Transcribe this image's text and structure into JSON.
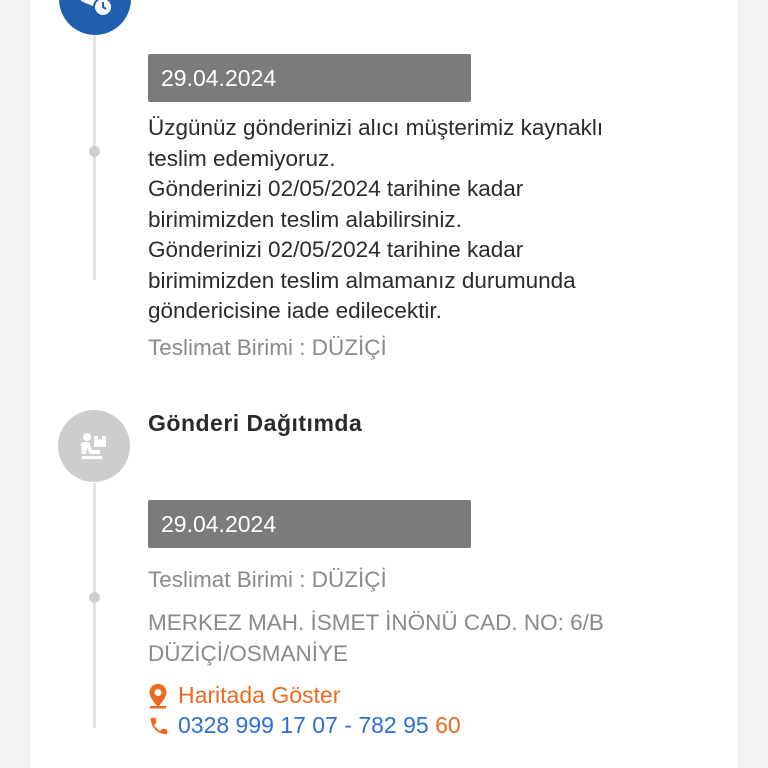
{
  "colors": {
    "accent_blue": "#1f5fae",
    "orange": "#ea6a1f",
    "link_blue": "#2c6fd1",
    "date_bar": "#7b7b7b"
  },
  "events": [
    {
      "icon": "delivery-clock-icon",
      "date": "29.04.2024",
      "message_lines": [
        "Üzgünüz gönderinizi alıcı müşterimiz kaynaklı",
        "teslim edemiyoruz.",
        "Gönderinizi 02/05/2024 tarihine kadar",
        "birimimizden teslim alabilirsiniz.",
        "Gönderinizi 02/05/2024 tarihine kadar",
        "birimimizden teslim almamanız durumunda",
        "göndericisine iade edilecektir."
      ],
      "unit": "Teslimat Birimi : DÜZİÇİ"
    },
    {
      "icon": "courier-package-icon",
      "title": "Gönderi Dağıtımda",
      "date": "29.04.2024",
      "unit": "Teslimat Birimi : DÜZİÇİ",
      "address_lines": [
        "MERKEZ MAH. İSMET İNÖNÜ CAD. NO: 6/B",
        "DÜZİÇİ/OSMANİYE"
      ],
      "map_link": "Haritada Göster",
      "phone_main": "0328 999 17 07",
      "phone_sep": " - ",
      "phone_ext_a": "782 95 ",
      "phone_ext_b": "60"
    }
  ]
}
